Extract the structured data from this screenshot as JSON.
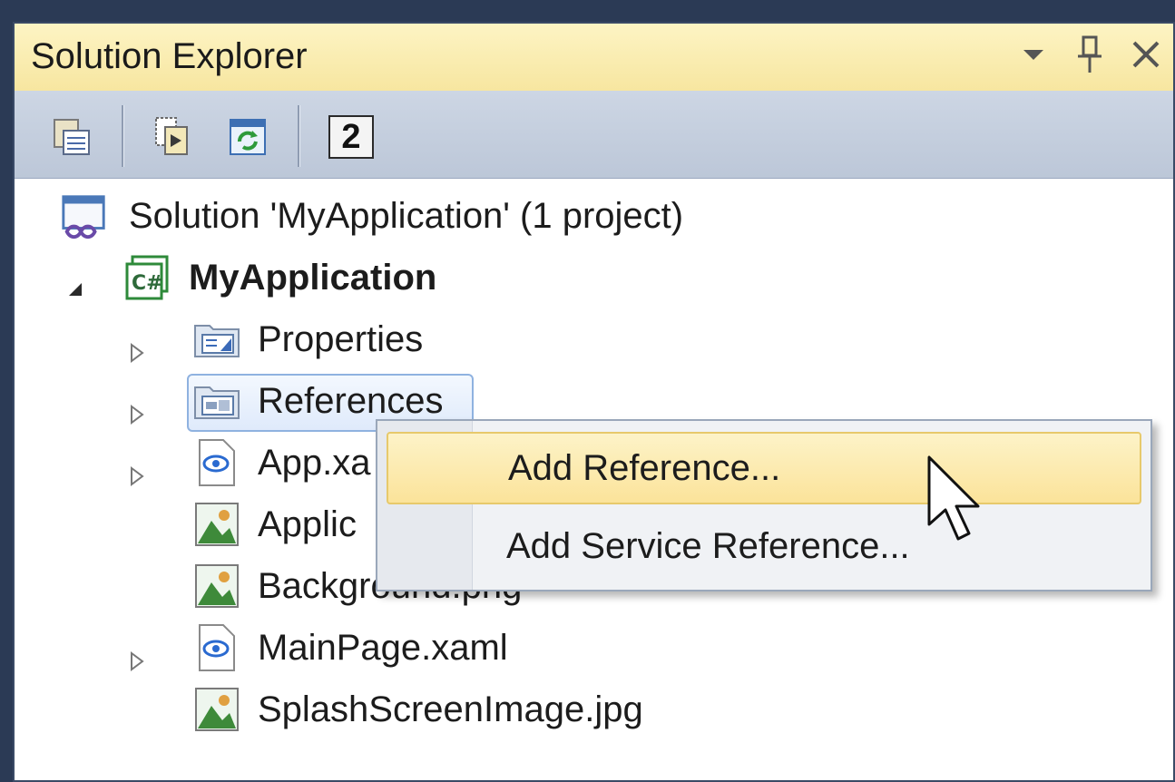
{
  "window": {
    "title": "Solution Explorer",
    "controls": {
      "dropdown": "▾",
      "pin": "📌",
      "close": "✕"
    }
  },
  "toolbar": {
    "buttons": [
      {
        "icon": "properties-icon"
      },
      {
        "icon": "show-all-files-icon"
      },
      {
        "icon": "refresh-icon"
      }
    ],
    "badge": "2"
  },
  "tree": {
    "solution": "Solution 'MyApplication' (1 project)",
    "project": "MyApplication",
    "items": [
      {
        "label": "Properties",
        "icon": "properties-folder-icon",
        "expandable": true
      },
      {
        "label": "References",
        "icon": "references-folder-icon",
        "expandable": true,
        "selected": true
      },
      {
        "label": "App.xa",
        "icon": "xaml-file-icon",
        "expandable": true
      },
      {
        "label": "Applic",
        "icon": "image-file-icon",
        "expandable": false
      },
      {
        "label": "Background.png",
        "icon": "image-file-icon",
        "expandable": false
      },
      {
        "label": "MainPage.xaml",
        "icon": "xaml-file-icon",
        "expandable": true
      },
      {
        "label": "SplashScreenImage.jpg",
        "icon": "image-file-icon",
        "expandable": false
      }
    ]
  },
  "context_menu": {
    "items": [
      {
        "label": "Add Reference...",
        "highlighted": true
      },
      {
        "label": "Add Service Reference...",
        "highlighted": false
      }
    ]
  },
  "colors": {
    "title_bar": "#f7e6a0",
    "toolbar": "#c4cede",
    "menu_highlight": "#fbe39a",
    "selection": "#dfeafb"
  }
}
